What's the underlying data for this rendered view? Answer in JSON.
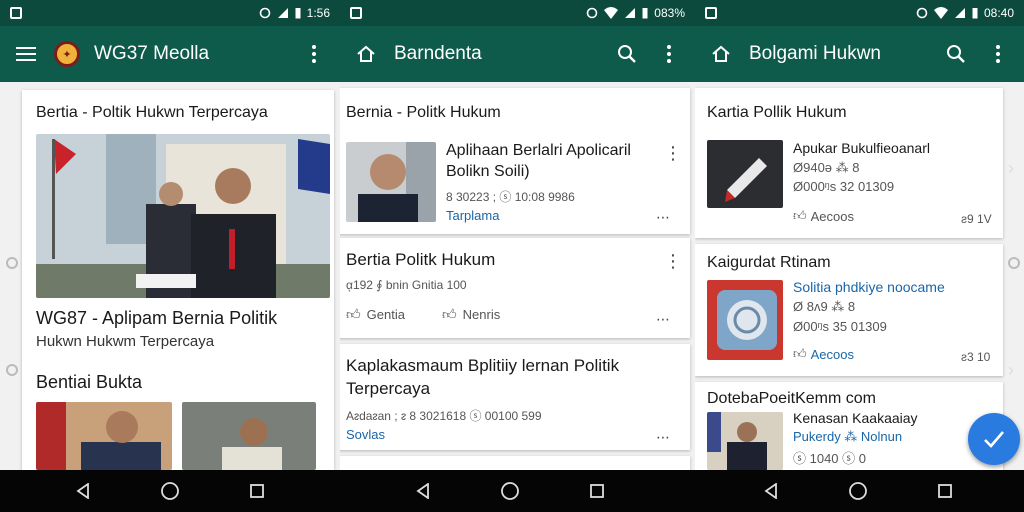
{
  "screen1": {
    "status_time": "1:56",
    "app_title": "WG37 Meolla",
    "card_header": "Bertia - Poltik Hukwn Terpercaya",
    "headline_line1": "WG87 - Aplipam Bernia Politik",
    "headline_line2": "Hukwn Hukwm Terpercaya",
    "section_title": "Bentiai Bukta"
  },
  "screen2": {
    "status_time": "083%",
    "app_title": "Barndenta",
    "card_header": "Bernia - Politk Hukum",
    "item1": {
      "title_line1": "Aplihaan Berlalri Apolicaril",
      "title_line2": "Bolikn Soili)",
      "meta": "8 30223 ; ⓢ 10:08 9986",
      "tag": "Tarplama"
    },
    "item2": {
      "title": "Bertia Politk Hukum",
      "meta": "ᾳ192 ∮ bnin Gnitia 100",
      "action1": "Gentia",
      "action2": "Nenris"
    },
    "item3": {
      "title_line1": "Kaplakasmaum Bplitiiy lernan Politik",
      "title_line2": "Terpercaya",
      "meta": "Aᴤdaᴤan ; ᴤ 8 3021618 ⓢ 00100 599",
      "tag": "Sovlas"
    }
  },
  "screen3": {
    "status_time": "08:40",
    "app_title": "Bolgami Hukwn",
    "card_header": "Kartia Pollik Hukum",
    "item1": {
      "title": "Apukar Bukulfieoanarl",
      "meta1": "Ø940ǝ ⁂ 8",
      "meta2": "Ø000ᵑs 32 01309",
      "action": "Aecoos",
      "value": "ƨ9 1V"
    },
    "item2_header": "Kaigurdat Rtinam",
    "item2": {
      "title": "Solitia phdkiye noocame",
      "meta1": "Ø 8ᴧ9 ⁂ 8",
      "meta2": "Ø00ᵑs 35 01309",
      "action": "Aecoos",
      "value": "ƨ3 10"
    },
    "item3_header": "DotebaPoeitKemm com",
    "item3": {
      "title1": "Kenasan Kaakaaiay",
      "title2": "Pukerdy ⁂ Nolnun",
      "meta": "ⓢ 1040 ⓢ 0"
    }
  },
  "colors": {
    "appbar": "#0e5a4b",
    "status": "#0c4a3d",
    "link": "#1a66a8",
    "fab": "#2a7be0"
  }
}
